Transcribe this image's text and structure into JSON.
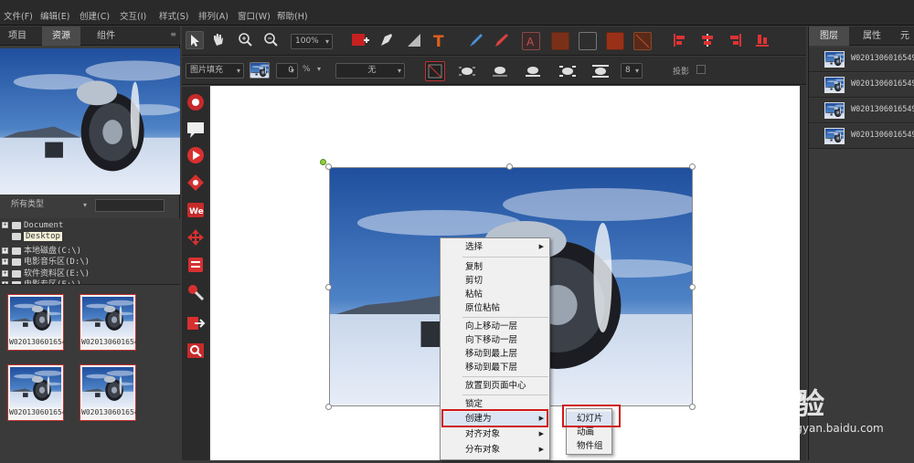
{
  "menu": [
    "文件(F)",
    "编辑(E)",
    "创建(C)",
    "交互(I)",
    "样式(S)",
    "排列(A)",
    "窗口(W)",
    "帮助(H)"
  ],
  "left_panel": {
    "tabs": [
      "项目",
      "资源",
      "组件"
    ],
    "filter_label": "所有类型",
    "tree": [
      {
        "label": "Document",
        "expandable": true,
        "selected": false
      },
      {
        "label": "Desktop",
        "expandable": false,
        "selected": true
      },
      {
        "label": "本地磁盘(C:\\)",
        "expandable": true,
        "selected": false
      },
      {
        "label": "电影音乐区(D:\\)",
        "expandable": true,
        "selected": false
      },
      {
        "label": "软件资料区(E:\\)",
        "expandable": true,
        "selected": false
      },
      {
        "label": "电影专区(F:\\)",
        "expandable": true,
        "selected": false
      }
    ],
    "thumbnails": [
      "W020130601654",
      "W020130601654",
      "W020130601654",
      "W020130601654"
    ]
  },
  "toolbar1": {
    "zoom": "100%"
  },
  "toolbar2": {
    "fill_mode": "图片填充",
    "opacity_value": "0",
    "opacity_unit": "%",
    "line_style": "无",
    "number_value": "8",
    "shadow_label": "投影"
  },
  "context_menu": {
    "items": [
      {
        "label": "选择",
        "submenu": true
      },
      {
        "label": "复制",
        "submenu": false
      },
      {
        "label": "剪切",
        "submenu": false
      },
      {
        "label": "粘帖",
        "submenu": false
      },
      {
        "label": "原位粘帖",
        "submenu": false
      },
      {
        "label": "向上移动一层",
        "submenu": false
      },
      {
        "label": "向下移动一层",
        "submenu": false
      },
      {
        "label": "移动到最上层",
        "submenu": false
      },
      {
        "label": "移动到最下层",
        "submenu": false
      },
      {
        "label": "放置到页面中心",
        "submenu": false
      },
      {
        "label": "锁定",
        "submenu": false
      },
      {
        "label": "创建为",
        "submenu": true
      },
      {
        "label": "对齐对象",
        "submenu": true
      },
      {
        "label": "分布对象",
        "submenu": true
      }
    ]
  },
  "submenu": {
    "items": [
      "幻灯片",
      "动画",
      "物件组"
    ]
  },
  "right_panel": {
    "tabs": [
      "图层",
      "属性",
      "元"
    ],
    "layers": [
      "W02013060165491",
      "W02013060165492",
      "W02013060165493",
      "W02013060165494"
    ]
  },
  "watermark": {
    "text": "Bai 经验",
    "url": "jingyan.baidu.com"
  },
  "colors": {
    "accent_red": "#d01919",
    "panel": "#3a3a3a",
    "menu_bg": "#f0f0f0"
  }
}
